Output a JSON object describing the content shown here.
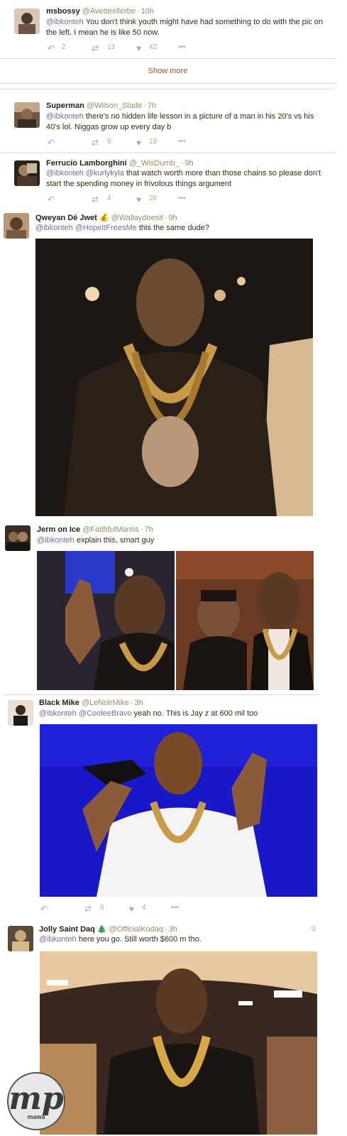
{
  "tweets": [
    {
      "name": "msbossy",
      "handle": "@Avetteellerbe",
      "time": "10h",
      "mention": "@ibkonteh",
      "text": " You don't think youth might have had something to do with the pic on the left.  I mean he is like 50 now.",
      "retweets": "13",
      "likes": "42",
      "replies": "2"
    },
    {
      "name": "Superman",
      "handle": "@Wilson_Slade",
      "time": "7h",
      "mention": "@ibkonteh",
      "text": " there's no hidden life lesson in a picture of a man in his 20's vs his 40's lol. Niggas grow up every day b",
      "retweets": "9",
      "likes": "19"
    },
    {
      "name": "Ferrucio Lamborghini",
      "handle": "@_WisDumb_",
      "time": "9h",
      "mention": "@ibkonteh @kurlykyla",
      "text": " that watch worth more than those chains so please don't start the spending money in frivolous things argument",
      "retweets": "4",
      "likes": "26"
    },
    {
      "name": "Qweyan Dé Jwet 💰",
      "handle": "@Wallaydoesit",
      "time": "9h",
      "mention": "@ibkonteh @HopeItFreesMe",
      "text": " this the same dude?"
    },
    {
      "name": "Jerm on Ice",
      "handle": "@FaithfulMantis",
      "time": "7h",
      "mention": "@ibkonteh",
      "text": " explain this, smart guy"
    },
    {
      "name": "Black Mike",
      "handle": "@LeNoirMike",
      "time": "3h",
      "mention": "@ibkonteh @CooleeBravo",
      "text": "  yeah no. This is Jay z at 600 mil too",
      "retweets": "6",
      "likes": "4"
    },
    {
      "name": "Jolly Saint Daq 🎄",
      "handle": "@OfficialKodaq",
      "time": "3h",
      "mention": "@ibkonteh",
      "text": " here you go. Still worth $600 m tho."
    }
  ],
  "show_more": "Show more",
  "more_glyph": "•••",
  "watermark": {
    "logo": "mp",
    "sub": "mawa"
  },
  "icons": {
    "reply": "reply-icon",
    "retweet": "retweet-icon",
    "like": "heart-icon",
    "more": "more-icon",
    "location": "location-pin-icon"
  }
}
